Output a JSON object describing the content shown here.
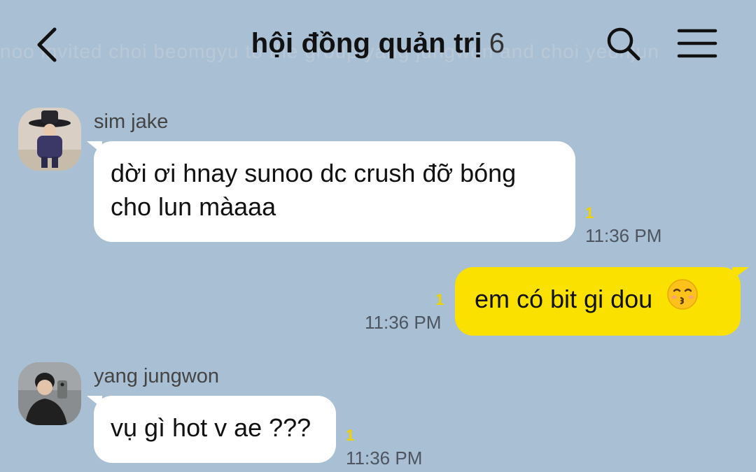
{
  "header": {
    "title": "hội đồng quản trị",
    "member_count": "6",
    "background_text": "noo invited choi beomgyu  to the group  yang jungwon and choi yeonjun"
  },
  "messages": [
    {
      "sender": "sim jake",
      "direction": "incoming",
      "lines": [
        "dời ơi hnay sunoo dc crush đỡ bóng",
        "cho lun màaaa"
      ],
      "unread": "1",
      "time": "11:36 PM"
    },
    {
      "direction": "outgoing",
      "text": "em có bit gi dou",
      "emoji": "kissing-face-icon",
      "unread": "1",
      "time": "11:36 PM"
    },
    {
      "sender": "yang jungwon",
      "direction": "incoming",
      "text": "vụ gì hot v ae ???",
      "unread": "1",
      "time": "11:36 PM"
    }
  ],
  "colors": {
    "background": "#a9bfd3",
    "incoming_bubble": "#ffffff",
    "outgoing_bubble": "#fae100",
    "unread_count": "#f1d300"
  }
}
